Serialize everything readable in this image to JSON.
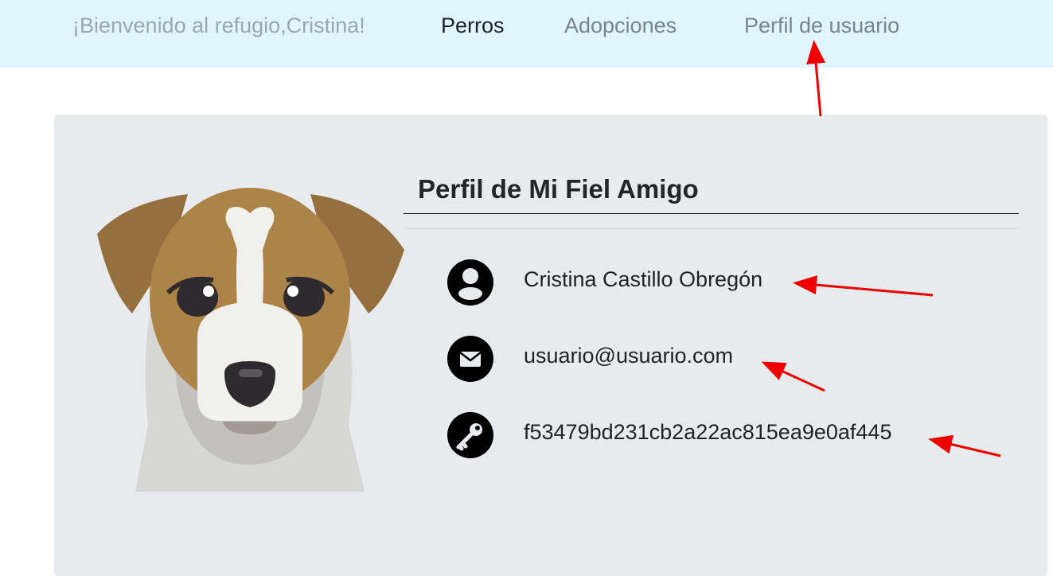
{
  "navbar": {
    "brand": "¡Bienvenido al refugio,Cristina!",
    "links": [
      "Perros",
      "Adopciones",
      "Perfil de usuario"
    ],
    "background": "#e1f5fe"
  },
  "profile": {
    "title": "Perfil de Mi Fiel Amigo",
    "fields": [
      {
        "icon": "user-circle-icon",
        "value": "Cristina Castillo Obregón"
      },
      {
        "icon": "envelope-icon",
        "value": "usuario@usuario.com"
      },
      {
        "icon": "key-icon",
        "value": "f53479bd231cb2a22ac815ea9e0af445"
      }
    ],
    "illustration": "dog-face-illustration"
  },
  "annotations": {
    "arrow_color": "#ee0000",
    "count": 4
  }
}
